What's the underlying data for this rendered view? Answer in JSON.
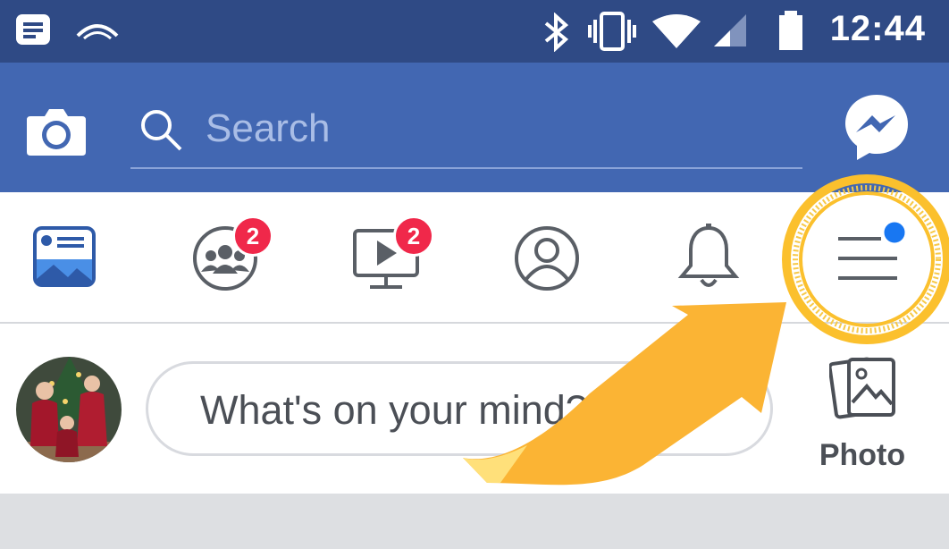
{
  "status_bar": {
    "time": "12:44",
    "icons": [
      "notification-icon",
      "cast-icon",
      "bluetooth-icon",
      "vibrate-icon",
      "wifi-icon",
      "signal-icon",
      "battery-icon"
    ]
  },
  "header": {
    "search_placeholder": "Search",
    "icons": [
      "camera-icon",
      "search-icon",
      "messenger-icon"
    ]
  },
  "nav": {
    "tabs": [
      {
        "name": "news-feed",
        "icon": "news-feed-icon",
        "badge": ""
      },
      {
        "name": "groups",
        "icon": "groups-icon",
        "badge": "2"
      },
      {
        "name": "watch",
        "icon": "watch-icon",
        "badge": "2"
      },
      {
        "name": "profile",
        "icon": "profile-icon",
        "badge": ""
      },
      {
        "name": "notifications",
        "icon": "bell-icon",
        "badge": ""
      },
      {
        "name": "menu",
        "icon": "menu-icon",
        "badge": ""
      }
    ],
    "menu_dot_color": "#1877f2"
  },
  "composer": {
    "prompt": "What's on your mind?",
    "photo_label": "Photo"
  },
  "annotation": {
    "highlight_color": "#fbc02d",
    "arrow_color": "#fbb434"
  }
}
